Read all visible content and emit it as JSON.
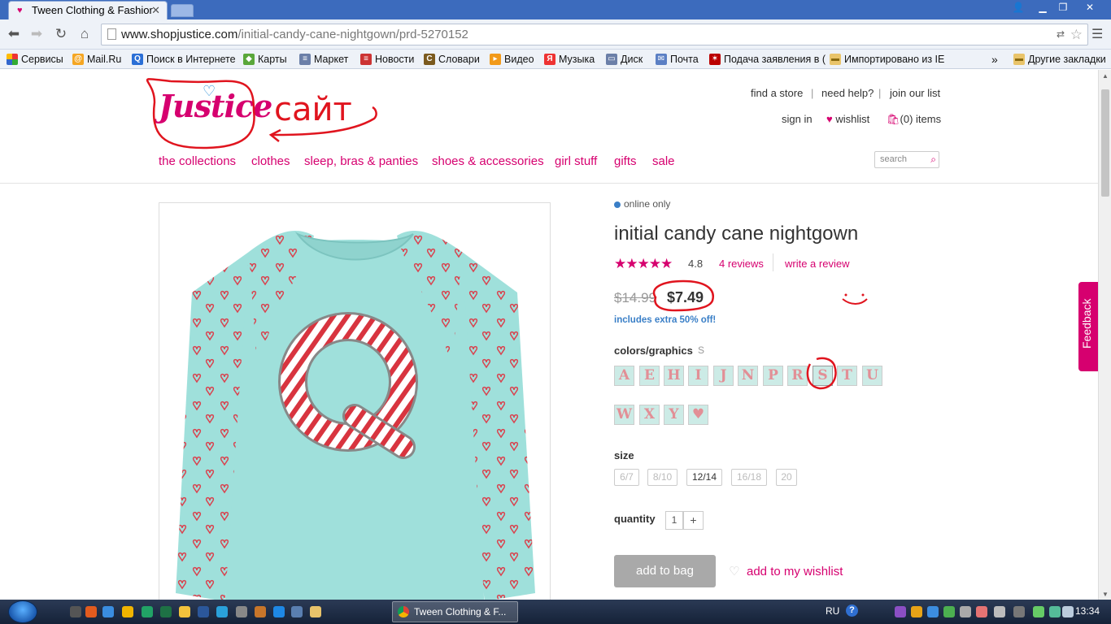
{
  "browser": {
    "tab_title": "Tween Clothing & Fashior",
    "url_host": "www.shopjustice.com",
    "url_path": "/initial-candy-cane-nightgown/prd-5270152",
    "bookmarks": [
      "Сервисы",
      "Mail.Ru",
      "Поиск в Интернете",
      "Карты",
      "Маркет",
      "Новости",
      "Словари",
      "Видео",
      "Музыка",
      "Диск",
      "Почта",
      "Подача заявления в (",
      "Импортировано из IE"
    ],
    "bookmarks_more": "»",
    "other_bookmarks": "Другие закладки"
  },
  "header": {
    "logo": "Justice",
    "annotation_text": "сайт",
    "find_store": "find a store",
    "need_help": "need help?",
    "join_list": "join our list",
    "sign_in": "sign in",
    "wishlist": "wishlist",
    "cart": "(0) items",
    "search_placeholder": "search",
    "nav": [
      "the collections",
      "clothes",
      "sleep, bras & panties",
      "shoes & accessories",
      "girl stuff",
      "gifts",
      "sale"
    ],
    "separator": "|"
  },
  "product": {
    "availability": "online only",
    "title": "initial candy cane nightgown",
    "rating": "4.8",
    "rating_value": 4.8,
    "stars": "★★★★★",
    "reviews": "4 reviews",
    "write_review": "write a review",
    "old_price": "$14.99",
    "new_price": "$7.49",
    "discount_note": "includes extra 50% off!",
    "colors_label": "colors/graphics",
    "colors_selected": "S",
    "swatches": [
      "A",
      "E",
      "H",
      "I",
      "J",
      "N",
      "P",
      "R",
      "S",
      "T",
      "U",
      "W",
      "X",
      "Y",
      "♥"
    ],
    "size_label": "size",
    "sizes": [
      "6/7",
      "8/10",
      "12/14",
      "16/18",
      "20"
    ],
    "selected_size": "12/14",
    "quantity_label": "quantity",
    "quantity": "1",
    "quantity_plus": "+",
    "add_to_bag": "add to bag",
    "add_to_wishlist": "add to my wishlist",
    "feedback": "Feedback",
    "shirt_letter": "Q"
  },
  "taskbar": {
    "task_title": "Tween Clothing & F...",
    "language": "RU",
    "help": "?",
    "time": "13:34"
  },
  "colors": {
    "brand": "#d6006f",
    "link_blue": "#3a7fc7",
    "annotation": "#e0141e",
    "shirt": "#9fe0db"
  }
}
